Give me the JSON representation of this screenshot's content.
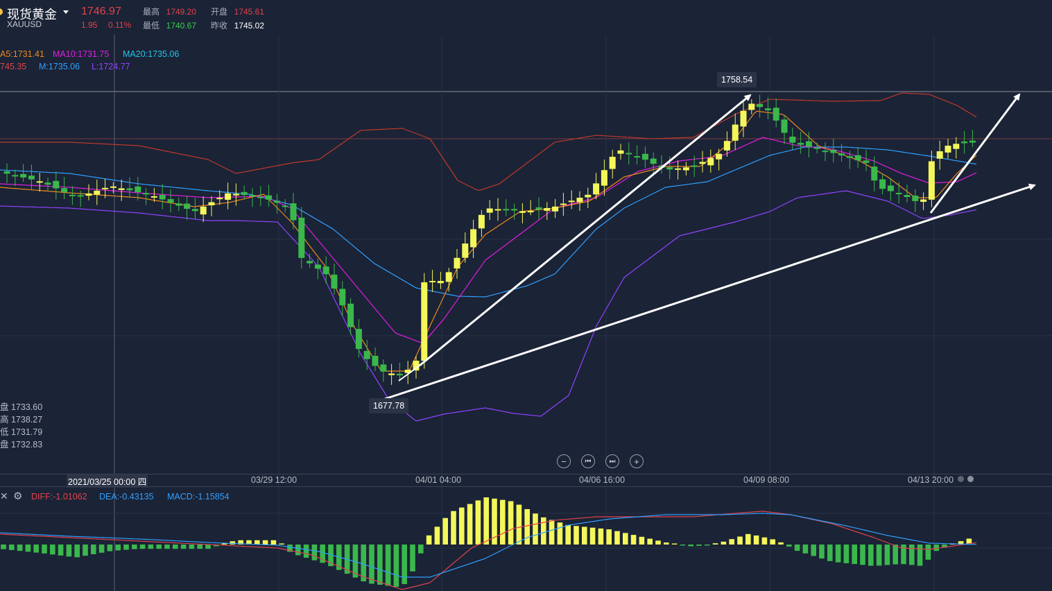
{
  "header": {
    "title": "现货黄金",
    "code": "XAUUSD",
    "price": "1746.97",
    "change": "1.95",
    "change_pct": "0.11%",
    "high_label": "最高",
    "high": "1749.20",
    "open_label": "开盘",
    "open": "1745.61",
    "low_label": "最低",
    "low": "1740.67",
    "prev_label": "昨收",
    "prev": "1745.02"
  },
  "indicators": {
    "ma5": "A5:1731.41",
    "ma10": "MA10:1731.75",
    "ma20": "MA20:1735.06",
    "boll_u": "745.35",
    "boll_m": "M:1735.06",
    "boll_l": "L:1724.77"
  },
  "side_info": {
    "open": "盘 1733.60",
    "high": "高 1738.27",
    "low": "低 1731.79",
    "close": "盘 1732.83"
  },
  "annotations": {
    "max": "1758.54",
    "min": "1677.78"
  },
  "x_axis": {
    "cursor": "2021/03/25 00:00 四",
    "labels": [
      "03/29 12:00",
      "04/01 04:00",
      "04/06 16:00",
      "04/09 08:00",
      "04/13 20:00"
    ]
  },
  "controls": {
    "zoom_out": "−",
    "prev": "⏮",
    "next": "⏭",
    "zoom_in": "+"
  },
  "macd": {
    "diff": "DIFF:-1.01062",
    "dea": "DEA:-0.43135",
    "macd": "MACD:-1.15854"
  },
  "colors": {
    "background": "#1b2336",
    "up_candle": "#f4f75a",
    "down_candle": "#3ab84c",
    "ma5": "#f08a1c",
    "ma10": "#e01ee0",
    "ma20": "#2fa0ff",
    "boll_upper": "#c0392b",
    "boll_lower": "#8e44ff",
    "trend_arrow": "#ffffff"
  }
}
